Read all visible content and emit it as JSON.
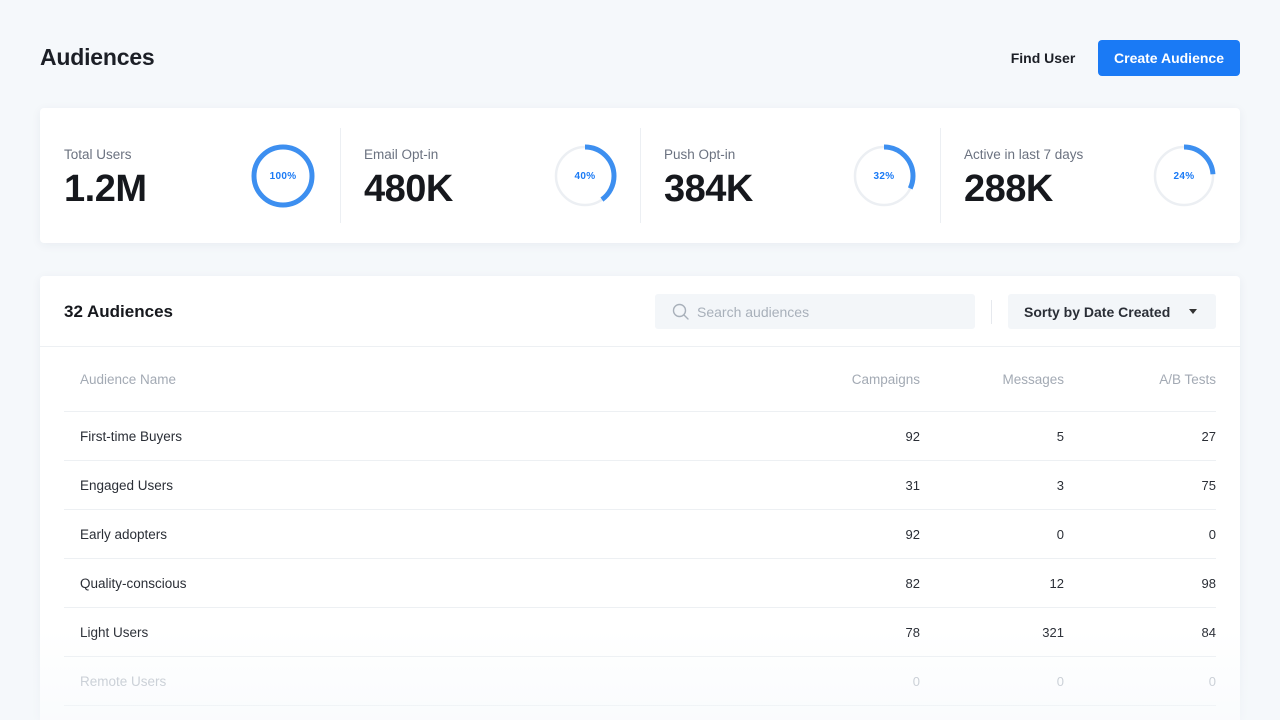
{
  "header": {
    "title": "Audiences",
    "find_user_label": "Find User",
    "create_audience_label": "Create Audience"
  },
  "stats": [
    {
      "label": "Total Users",
      "value": "1.2M",
      "percent_text": "100%",
      "fraction": 1.0
    },
    {
      "label": "Email Opt-in",
      "value": "480K",
      "percent_text": "40%",
      "fraction": 0.4
    },
    {
      "label": "Push Opt-in",
      "value": "384K",
      "percent_text": "32%",
      "fraction": 0.32
    },
    {
      "label": "Active in last 7 days",
      "value": "288K",
      "percent_text": "24%",
      "fraction": 0.24
    }
  ],
  "audiences": {
    "count_label": "32 Audiences",
    "search_placeholder": "Search audiences",
    "sort_label": "Sorty by Date Created",
    "columns": [
      "Audience Name",
      "Campaigns",
      "Messages",
      "A/B Tests"
    ],
    "rows": [
      {
        "name": "First-time Buyers",
        "campaigns": "92",
        "messages": "5",
        "ab_tests": "27"
      },
      {
        "name": "Engaged Users",
        "campaigns": "31",
        "messages": "3",
        "ab_tests": "75"
      },
      {
        "name": "Early adopters",
        "campaigns": "92",
        "messages": "0",
        "ab_tests": "0"
      },
      {
        "name": "Quality-conscious",
        "campaigns": "82",
        "messages": "12",
        "ab_tests": "98"
      },
      {
        "name": "Light Users",
        "campaigns": "78",
        "messages": "321",
        "ab_tests": "84"
      },
      {
        "name": "Remote Users",
        "campaigns": "0",
        "messages": "0",
        "ab_tests": "0"
      }
    ]
  },
  "colors": {
    "accent": "#1a7af5",
    "ring_progress": "#3d8ff0",
    "ring_track": "#eceff3"
  },
  "icons": {
    "search": "search-icon",
    "sort_caret": "chevron-down-icon"
  }
}
